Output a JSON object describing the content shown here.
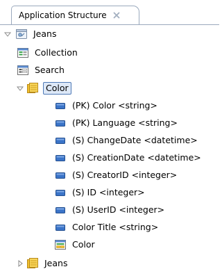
{
  "tab": {
    "label": "Application Structure",
    "close_icon": "close-view-icon"
  },
  "tree": {
    "root": {
      "label": "Jeans",
      "icon": "application-icon",
      "expanded": true
    },
    "items": {
      "collection": {
        "label": "Collection",
        "icon": "collection-form-icon"
      },
      "search": {
        "label": "Search",
        "icon": "search-form-icon"
      },
      "color": {
        "label": "Color",
        "icon": "entity-icon",
        "expanded": true,
        "selected": true,
        "attributes": [
          {
            "label": "(PK) Color <string>"
          },
          {
            "label": "(PK) Language <string>"
          },
          {
            "label": "(S) ChangeDate <datetime>"
          },
          {
            "label": "(S) CreationDate <datetime>"
          },
          {
            "label": "(S) CreatorID <integer>"
          },
          {
            "label": "(S) ID <integer>"
          },
          {
            "label": "(S) UserID <integer>"
          },
          {
            "label": "Color Title <string>"
          }
        ],
        "form": {
          "label": "Color",
          "icon": "entity-form-icon"
        }
      },
      "jeans": {
        "label": "Jeans",
        "icon": "entity-icon",
        "expanded": false
      }
    }
  },
  "colors": {
    "selection_border": "#4e79b6",
    "selection_fill": "#dde8f7",
    "attribute_icon": "#3b74c8"
  }
}
